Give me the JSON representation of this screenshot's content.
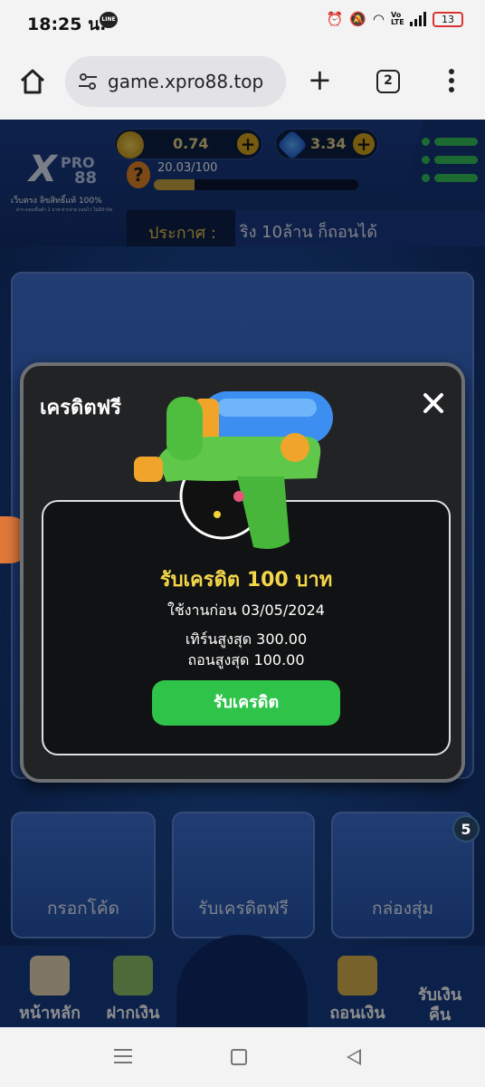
{
  "status_bar": {
    "time": "18:25 น.",
    "line_label": "LINE",
    "volte_label": "Vo LTE",
    "battery": "13"
  },
  "browser": {
    "url": "game.xpro88.top",
    "plus": "+",
    "tab_count": "2"
  },
  "game": {
    "logo": {
      "x": "X",
      "pro": "PRO",
      "n88": "88",
      "tagline": "เว็บตรง ลิขสิทธิ์แท้ 100%",
      "subtag": "ฝาก-ถอนขั้นต่ำ 1 บาท ฝากง่าย ถอนไว ไม่มีจำกัด"
    },
    "coin_balance": "0.74",
    "gem_balance": "3.34",
    "level_text": "20.03/100",
    "level_progress": 0.2003,
    "level_icon": "?",
    "announce_label": "ประกาศ :",
    "announce_text": "ริง 10ล้าน ก็ถอนได้",
    "panels": {
      "code": "กรอกโค้ด",
      "free": "รับเครดิตฟรี",
      "box": "กล่องสุ่ม"
    },
    "bottom_nav": {
      "home": "หน้าหลัก",
      "deposit": "ฝากเงิน",
      "withdraw": "ถอนเงิน",
      "cashback": "รับเงินคืน"
    },
    "badge_count": "5",
    "colors": {
      "accent_green": "#2fc34a",
      "title_yellow": "#f4d64a",
      "bg_blue": "#1a468f"
    }
  },
  "modal": {
    "title": "เครดิตฟรี",
    "headline": "รับเครดิต 100 บาท",
    "expiry": "ใช้งานก่อน 03/05/2024",
    "max_turnover": "เทิร์นสูงสุด 300.00",
    "max_withdraw": "ถอนสูงสุด 100.00",
    "button": "รับเครดิต"
  },
  "icons": [
    "home-icon",
    "tune-icon",
    "plus-icon",
    "tabs-icon",
    "more-icon",
    "close-icon",
    "water-gun-icon",
    "coin-icon",
    "gem-icon",
    "menu-icon"
  ]
}
